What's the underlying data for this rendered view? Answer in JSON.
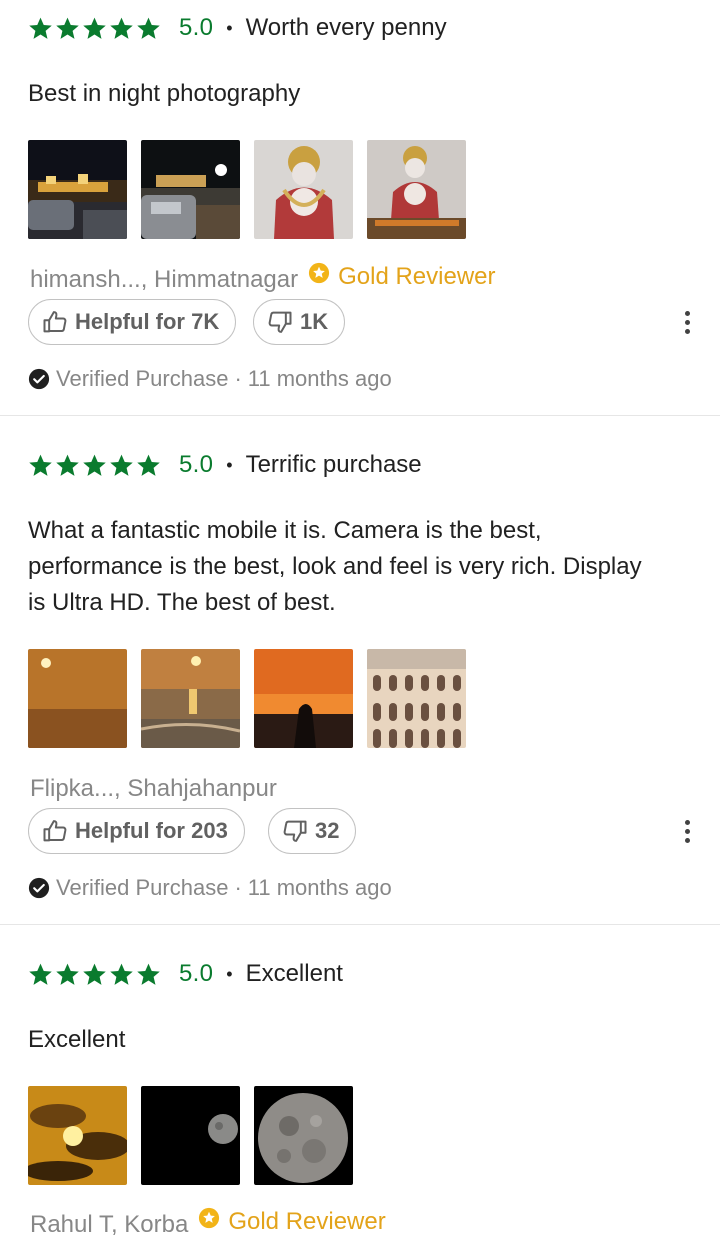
{
  "reviews": [
    {
      "rating": "5.0",
      "separator": "•",
      "headline": "Worth every penny",
      "body": "Best in night photography",
      "photos": [
        "night-street-photo",
        "night-street-photo",
        "deity-idol-photo",
        "deity-idol-photo"
      ],
      "author": "himansh..., Himmatnagar",
      "badge": "Gold Reviewer",
      "helpful_label": "Helpful for 7K",
      "dislike_count": "1K",
      "verified_label": "Verified Purchase",
      "dot_sep": "·",
      "time_ago": "11 months ago"
    },
    {
      "rating": "5.0",
      "separator": "•",
      "headline": "Terrific purchase",
      "body": "What a fantastic mobile it is. Camera is the best, performance is the best,  look and feel is very rich. Display is Ultra HD. The best of best.",
      "photos": [
        "sunset-sky-photo",
        "sunset-beach-photo",
        "sunset-silhouette-photo",
        "arched-building-photo"
      ],
      "author": "Flipka..., Shahjahanpur",
      "badge": "",
      "helpful_label": "Helpful for 203",
      "dislike_count": "32",
      "verified_label": "Verified Purchase",
      "dot_sep": "·",
      "time_ago": "11 months ago"
    },
    {
      "rating": "5.0",
      "separator": "•",
      "headline": "Excellent",
      "body": "Excellent",
      "photos": [
        "cloudy-sunset-photo",
        "small-moon-photo",
        "moon-closeup-photo"
      ],
      "author": "Rahul  T, Korba",
      "badge": "Gold Reviewer"
    }
  ],
  "colors": {
    "star_green": "#0a7b2e",
    "gold": "#e3a31a",
    "muted_text": "#878787"
  },
  "icons": {
    "star": "star-icon",
    "thumbs_up": "thumbs-up-icon",
    "thumbs_down": "thumbs-down-icon",
    "verified": "check-circle-icon",
    "more": "more-vertical-icon",
    "gold": "gold-star-badge-icon"
  }
}
